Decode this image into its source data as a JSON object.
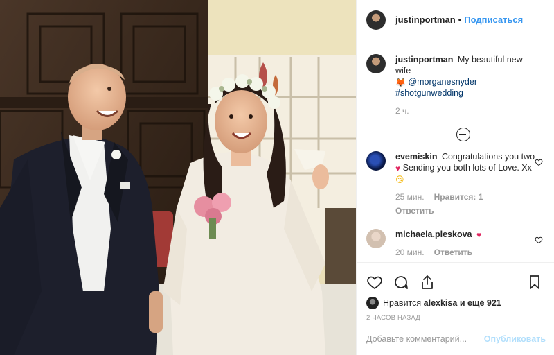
{
  "post": {
    "author": "justinportman",
    "follow_label": "Подписаться",
    "dot": "•"
  },
  "caption": {
    "user": "justinportman",
    "text": "My beautiful new wife",
    "emoji": "🦊",
    "mention": "@morganesnyder",
    "hashtag": "#shotgunwedding",
    "time": "2 ч."
  },
  "comments": [
    {
      "user": "evemiskin",
      "text_a": "Congratulations you two",
      "emoji_a": "♥",
      "text_b": "Sending you both lots of Love. Xx",
      "emoji_b": "😘",
      "time": "25 мин.",
      "likes": "Нравится: 1",
      "reply": "Ответить"
    },
    {
      "user": "michaela.pleskova",
      "emoji_a": "♥",
      "time": "20 мин.",
      "reply": "Ответить"
    }
  ],
  "likes": {
    "prefix": "Нравится",
    "user": "alexkisa",
    "suffix": "и ещё 921"
  },
  "time_ago": "2 ЧАСОВ НАЗАД",
  "add_comment": {
    "placeholder": "Добавьте комментарий...",
    "publish_label": "Опубликовать"
  },
  "colors": {
    "accent_blue": "#3897f0",
    "link_dark": "#003569",
    "publish_disabled": "#b2dffc",
    "heart_red": "#e0245e"
  }
}
